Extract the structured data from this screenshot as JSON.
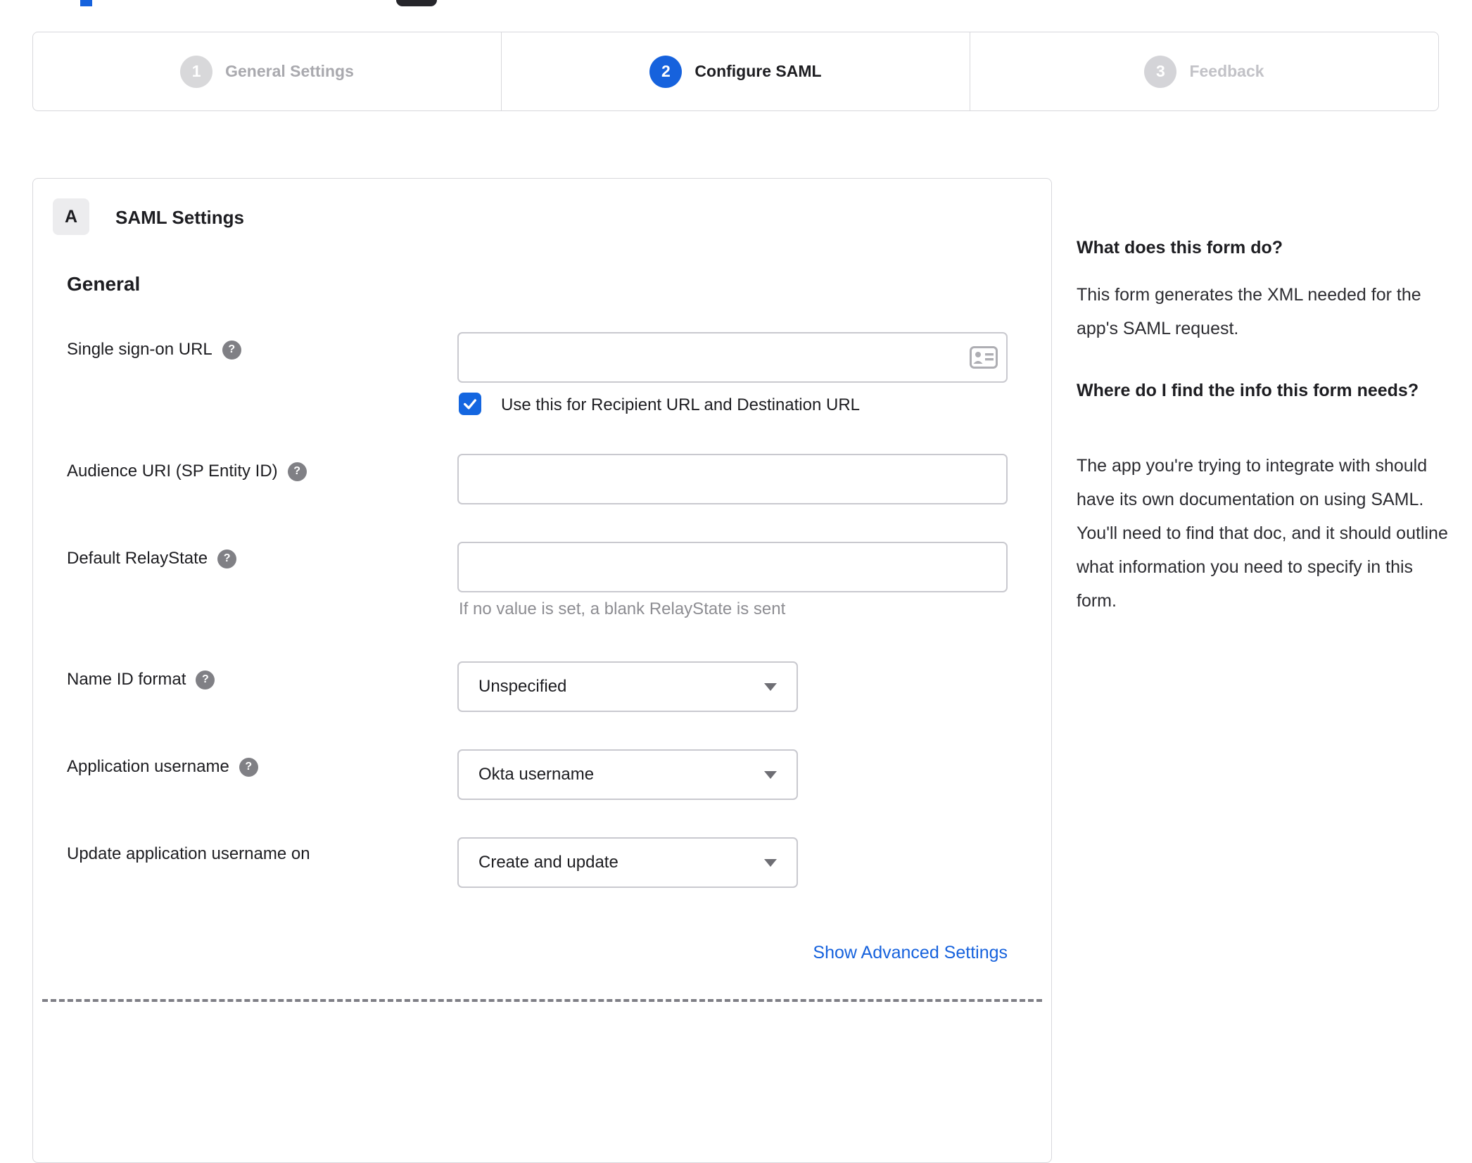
{
  "stepper": {
    "steps": [
      {
        "number": "1",
        "label": "General Settings",
        "state": "done"
      },
      {
        "number": "2",
        "label": "Configure SAML",
        "state": "active"
      },
      {
        "number": "3",
        "label": "Feedback",
        "state": "todo"
      }
    ]
  },
  "panel": {
    "badge": "A",
    "title": "SAML Settings",
    "section_heading": "General",
    "fields": {
      "sso_url": {
        "label": "Single sign-on URL",
        "value": "",
        "checkbox_label": "Use this for Recipient URL and Destination URL",
        "checkbox_checked": true
      },
      "audience_uri": {
        "label": "Audience URI (SP Entity ID)",
        "value": ""
      },
      "relay_state": {
        "label": "Default RelayState",
        "value": "",
        "help": "If no value is set, a blank RelayState is sent"
      },
      "name_id": {
        "label": "Name ID format",
        "value": "Unspecified"
      },
      "app_username": {
        "label": "Application username",
        "value": "Okta username"
      },
      "update_username": {
        "label": "Update application username on",
        "value": "Create and update"
      }
    },
    "advanced_link": "Show Advanced Settings"
  },
  "sidebar": {
    "heading1": "What does this form do?",
    "body1": "This form generates the XML needed for the app's SAML request.",
    "heading2": "Where do I find the info this form needs?",
    "body2": "The app you're trying to integrate with should have its own documentation on using SAML. You'll need to find that doc, and it should outline what information you need to specify in this form."
  },
  "colors": {
    "accent": "#1662dd",
    "checkbox_blue": "#1466e0",
    "border_gray": "#d8d8dc",
    "muted_text": "#8d8d92"
  }
}
